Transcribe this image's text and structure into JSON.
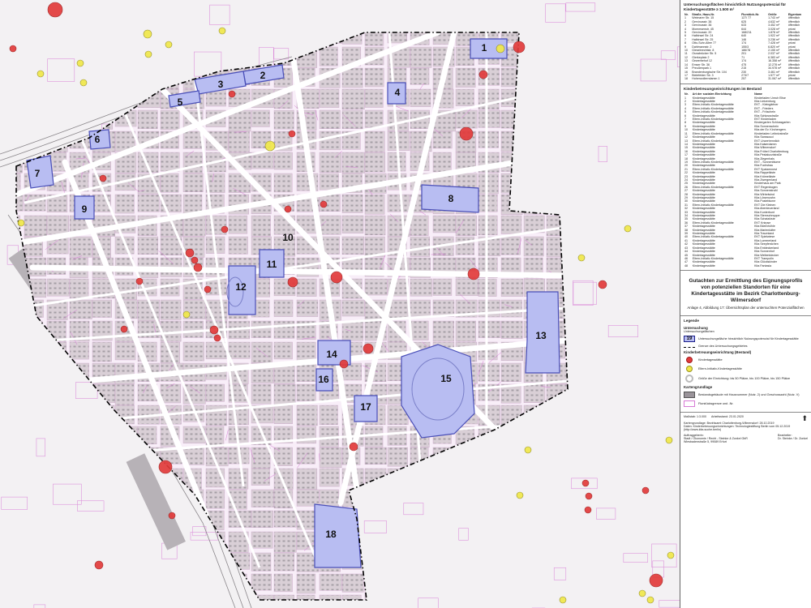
{
  "map": {
    "area_labels": [
      "1",
      "2",
      "3",
      "4",
      "5",
      "6",
      "7",
      "8",
      "9",
      "10",
      "11",
      "12",
      "13",
      "14",
      "15",
      "16",
      "17",
      "18"
    ],
    "colors": {
      "parcel_line": "#d77bd6",
      "block_fill": "#d9cfd6",
      "building_fill": "#9a949a",
      "area_fill": "#b8bdf2",
      "area_stroke": "#4a4fb8",
      "boundary": "#000000",
      "kita_red": "#e23b3b",
      "kita_yellow": "#f0e84a"
    }
  },
  "panel": {
    "table1": {
      "title": "Untersuchungsflächen hinsichtlich Nutzungspotenzial für Kindertagesstätte ≥ 1.500 m²",
      "headers": [
        "Nr.",
        "Straße, Haus-Nr.",
        "Flurstück-Nr.",
        "Größe",
        "Eigentum"
      ],
      "rows": [
        [
          "1",
          "Weimarer Str. 15",
          "127/ 77",
          "1.743 m²",
          "öffentlich"
        ],
        [
          "2",
          "Gervinusstr. 38",
          "625",
          "4.632 m²",
          "öffentlich"
        ],
        [
          "3",
          "Gervinusstr. 36",
          "633",
          "3.452 m²",
          "öffentlich"
        ],
        [
          "4",
          "Mommsenstr. 45",
          "644",
          "3.028 m²",
          "privat"
        ],
        [
          "5",
          "Gervinusstr. 20",
          "168/211",
          "1.878 m²",
          "öffentlich"
        ],
        [
          "6",
          "Halbinsel Str. 24",
          "640",
          "1.922 m²",
          "öffentlich"
        ],
        [
          "7",
          "Halbinsel Str. 25",
          "146",
          "3.236 m²",
          "öffentlich"
        ],
        [
          "8",
          "Otto-Suhr-Allee 77",
          "174",
          "7.428 m²",
          "privat"
        ],
        [
          "9",
          "Dahlmannstr. 2",
          "155/3",
          "6.820 m²",
          "privat"
        ],
        [
          "10",
          "Giesebrechtstr. 8",
          "186/78",
          "2.155 m²",
          "öffentlich"
        ],
        [
          "11",
          "Osnabrücker Str. 5",
          "201",
          "2.037 m²",
          "öffentlich"
        ],
        [
          "12",
          "Gierkeplatz 2",
          "71",
          "6.383 m²",
          "öffentlich"
        ],
        [
          "13",
          "Gewerbehof 12",
          "174",
          "16.358 m²",
          "öffentlich"
        ],
        [
          "14",
          "Emser Str. 36",
          "475",
          "12.278 m²",
          "öffentlich"
        ],
        [
          "15",
          "Preußenpark 1",
          "215",
          "34.978 m²",
          "öffentlich"
        ],
        [
          "16",
          "Brandenburgische Str. 104",
          "230",
          "3.461 m²",
          "öffentlich"
        ],
        [
          "17",
          "Bielefelder Str. 3",
          "273/7",
          "1.577 m²",
          "privat"
        ],
        [
          "18",
          "Hohenzollerndamm 1",
          "257",
          "31.067 m²",
          "öffentlich"
        ]
      ]
    },
    "table2": {
      "title": "Kinderbetreuungseinrichtungen im Bestand",
      "headers": [
        "Nr.",
        "Art der sozialen Einrichtung",
        "Name"
      ],
      "rows": [
        [
          "1",
          "Kindertagesstätte",
          "Kinderladen Unruh Elise"
        ],
        [
          "2",
          "Kindertagesstätte",
          "Kita Lietzenburg"
        ],
        [
          "3",
          "Eltern-Initiativ-Kindertagesstätte",
          "EKT - Kleingärtner"
        ],
        [
          "4",
          "Eltern-Initiativ-Kindertagesstätte",
          "EKT - Frieders"
        ],
        [
          "5",
          "Eltern-Initiativ-Kindertagesstätte",
          "EKT - Fröscheln"
        ],
        [
          "6",
          "Kindertagesstätte",
          "Kita Schlossstraße"
        ],
        [
          "7",
          "Eltern-Initiativ-Kindertagesstätte",
          "EKT Kinderladen"
        ],
        [
          "8",
          "Kindertagesstätte",
          "Kindergarten Schlossgarten"
        ],
        [
          "9",
          "Kindertagesstätte",
          "Kita Sonnenschein"
        ],
        [
          "10",
          "Kindertagesstätte",
          "Kita der Ev. Kirchengem."
        ],
        [
          "11",
          "Eltern-Initiativ-Kindertagesstätte",
          "Kinderladen Leibnizstraße"
        ],
        [
          "12",
          "Kindertagesstätte",
          "Kita Sanssouci"
        ],
        [
          "13",
          "Eltern-Initiativ-Kindertagesstätte",
          "EKT Unzertrennlich"
        ],
        [
          "14",
          "Kindertagesstätte",
          "Kita Kaiserdamm"
        ],
        [
          "15",
          "Kindertagesstätte",
          "Kita Wilmersdorf"
        ],
        [
          "16",
          "Kindertagesstätte",
          "Kita Fröbel Charlottenburg"
        ],
        [
          "17",
          "Kindertagesstätte",
          "Kita Pestalozzistraße"
        ],
        [
          "18",
          "Kindertagesstätte",
          "Kita Ziegenhals"
        ],
        [
          "19",
          "Eltern-Initiativ-Kindertagesstätte",
          "EKT - Sonnenblume"
        ],
        [
          "20",
          "Kindertagesstätte",
          "Kita Fuchsbau"
        ],
        [
          "21",
          "Eltern-Initiativ-Kindertagesstätte",
          "EKT Spatzennest"
        ],
        [
          "22",
          "Kindertagesstätte",
          "Kita Rappelkiste"
        ],
        [
          "23",
          "Kindertagesstätte",
          "Kita Krümelkiste"
        ],
        [
          "24",
          "Kindertagesstätte",
          "Kita Zwergenland"
        ],
        [
          "25",
          "Kindertagesstätte",
          "Kinderhaus am Park"
        ],
        [
          "26",
          "Eltern-Initiativ-Kindertagesstätte",
          "EKT Regenbogen"
        ],
        [
          "27",
          "Kindertagesstätte",
          "Kita Sonnenstrahl"
        ],
        [
          "28",
          "Kindertagesstätte",
          "Kita Wirbelwind"
        ],
        [
          "29",
          "Kindertagesstätte",
          "Kita Löwenzahn"
        ],
        [
          "30",
          "Kindertagesstätte",
          "Kita Pusteblume"
        ],
        [
          "31",
          "Eltern-Initiativ-Kindertagesstätte",
          "EKT Die Kleinen"
        ],
        [
          "32",
          "Kindertagesstätte",
          "Kita Abenteuerland"
        ],
        [
          "33",
          "Kindertagesstätte",
          "Kita Kunterbunt"
        ],
        [
          "34",
          "Kindertagesstätte",
          "Kita Sternschnuppe"
        ],
        [
          "35",
          "Kindertagesstätte",
          "Kita Schatzkiste"
        ],
        [
          "36",
          "Eltern-Initiativ-Kindertagesstätte",
          "EKT Knirpse"
        ],
        [
          "37",
          "Kindertagesstätte",
          "Kita Bärenhöhle"
        ],
        [
          "38",
          "Kindertagesstätte",
          "Kita Marienkäfer"
        ],
        [
          "39",
          "Kindertagesstätte",
          "Kita Traumland"
        ],
        [
          "40",
          "Eltern-Initiativ-Kindertagesstätte",
          "EKT Spielwiese"
        ],
        [
          "41",
          "Kindertagesstätte",
          "Kita Lummerland"
        ],
        [
          "42",
          "Kindertagesstätte",
          "Kita Seepferdchen"
        ],
        [
          "43",
          "Kindertagesstätte",
          "Kita Entdeckerland"
        ],
        [
          "44",
          "Kindertagesstätte",
          "Kita Sonnenhof"
        ],
        [
          "45",
          "Kindertagesstätte",
          "Kita Weltentdecker"
        ],
        [
          "46",
          "Eltern-Initiativ-Kindertagesstätte",
          "EKT Trampolin"
        ],
        [
          "47",
          "Kindertagesstätte",
          "Kita Glückskinder"
        ],
        [
          "48",
          "Kindertagesstätte",
          "Kita Fantasia"
        ]
      ]
    },
    "title_block": {
      "main": "Gutachten zur Ermittlung des Eignungsprofils von potenziellen Standorten für eine Kindertagesstätte im Bezirk Charlottenburg-Wilmersdorf",
      "sub": "Anlage 4, Abbildung 17: Übersichtsplan der untersuchten Potenzialflächen"
    },
    "legend": {
      "title": "Legende",
      "sec_study": "Untersuchung",
      "study_area_sub": "Untersuchungsflächen",
      "area_number": "19",
      "area_label": "Untersuchungsfläche hinsichtlich Nutzungspotenzial für Kindertagesstätte",
      "boundary_label": "Grenze des Untersuchungsgebietes",
      "sec_kita": "Kinderbetreuungseinrichtung (Bestand)",
      "kita_label": "Kindertagesstätte",
      "ekt_label": "Eltern-Initiativ-Kindertagesstätte",
      "size_label": "Größe der Einrichtung: bis 50 Plätze, bis 100 Plätze, bis 150 Plätze",
      "sec_base": "Kartengrundlage",
      "buildings_label": "Bestandsgebäude mit Hausnummer (Nutz. 2) und Geschosszahl (Nutz. V)",
      "parcels_label": "Flurstücksgrenze und -Nr."
    },
    "footer": {
      "scale": "Maßstab: 1:3.000",
      "date": "Arbeitsstand: 23.01.2020",
      "basis": "Kartengrundlage: Bezirksamt Charlottenburg-Wilmersdorf: 28.10.2019",
      "source": "Daten: Kinderbetreuungseinrichtungen: Technologiestiftung Berlin vom 05.12.2019 (http://www.kita-suche.berlin)",
      "client_label": "Auftraggeberin:",
      "client": "Stadt / Ökonomie / Recht - Steinke & Zonkel GbR",
      "client_addr": "Wiesbadenstraße 5, 99089 Erfurt",
      "editor_label": "Bearbeiter:",
      "editors": "Dr. Steinke / Dr. Zonkel"
    }
  }
}
